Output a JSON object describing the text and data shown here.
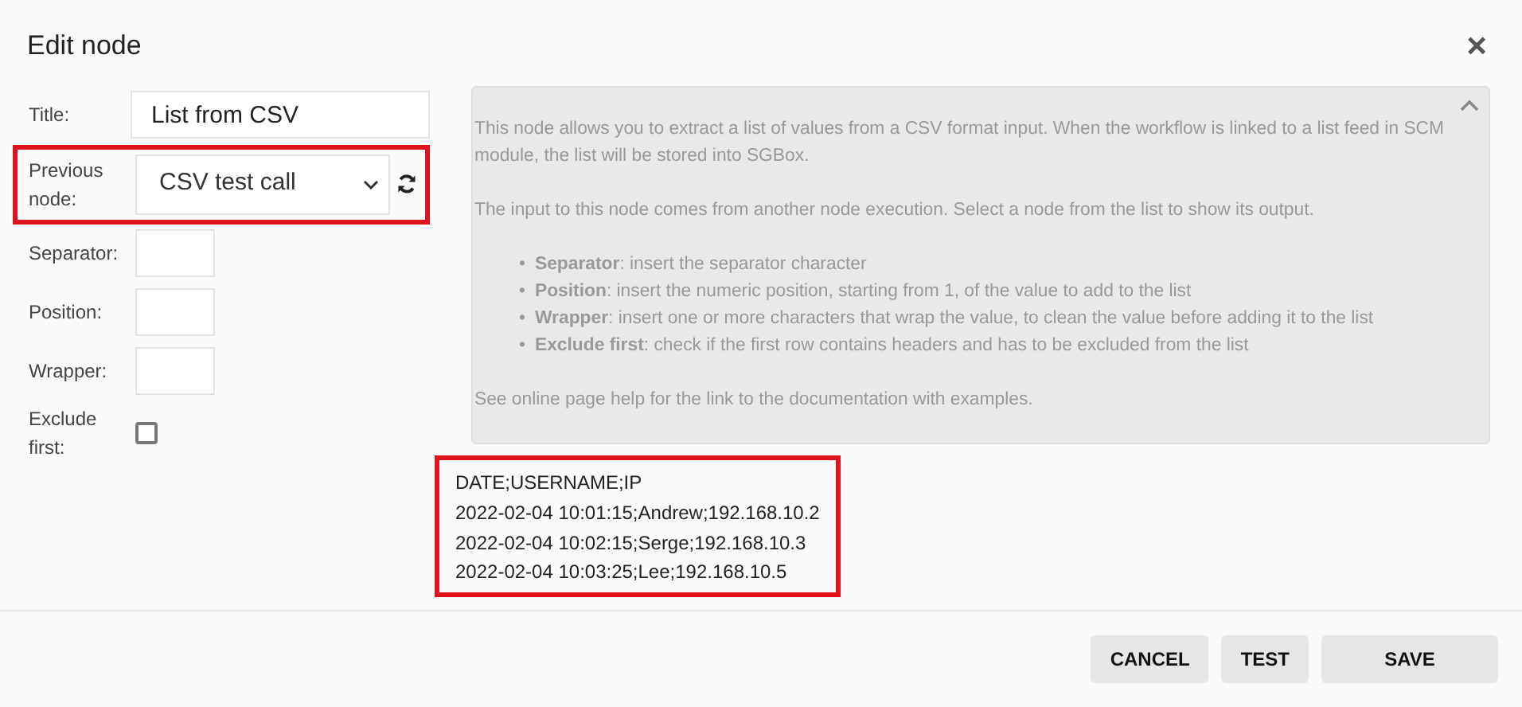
{
  "dialog": {
    "title": "Edit node",
    "close": "×"
  },
  "fields": [
    {
      "kind": "text",
      "label": "Title:",
      "value": "List from CSV"
    },
    {
      "kind": "select",
      "label": "Previous node:",
      "value": "CSV test call",
      "highlighted": true
    },
    {
      "kind": "short",
      "label": "Separator:"
    },
    {
      "kind": "short",
      "label": "Position:"
    },
    {
      "kind": "short",
      "label": "Wrapper:"
    },
    {
      "kind": "checkbox",
      "label": "Exclude first:",
      "checked": false
    }
  ],
  "help": {
    "expanded": true,
    "paragraphs": [
      "This node allows you to extract a list of values from a CSV format input. When the workflow is linked to a list feed in SCM module, the list will be stored into SGBox.",
      "The input to this node comes from another node execution. Select a node from the list to show its output."
    ],
    "bullets": [
      {
        "marker": "•",
        "text": "**Separator**: insert the separator character"
      },
      {
        "marker": "•",
        "text": "**Position**: insert the numeric position, starting from 1, of the value to add to the list"
      },
      {
        "marker": "•",
        "text": "**Wrapper**: insert one or more characters that wrap the value, to clean the value before adding it to the list"
      },
      {
        "marker": "•",
        "text": "**Exclude first**: check if the first row contains headers and has to be excluded from the list"
      }
    ],
    "footer": "See online page help for the link to the documentation with examples."
  },
  "output": {
    "highlighted": true,
    "lines": [
      "DATE;USERNAME;IP",
      "2022-02-04 10:01:15;Andrew;192.168.10.2",
      "2022-02-04 10:02:15;Serge;192.168.10.3",
      "2022-02-04 10:03:25;Lee;192.168.10.5"
    ]
  },
  "buttons": [
    "CANCEL",
    "TEST",
    "SAVE"
  ]
}
